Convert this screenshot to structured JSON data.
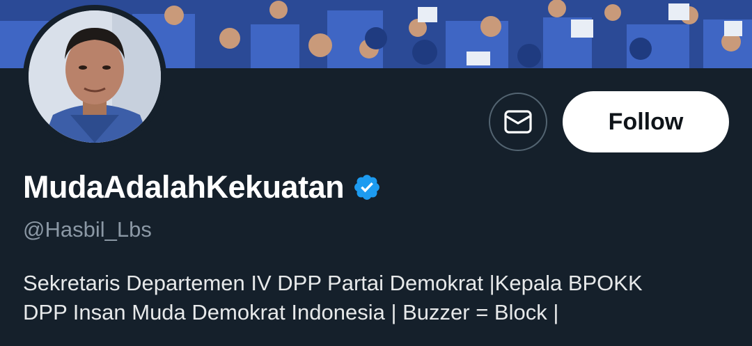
{
  "profile": {
    "display_name": "MudaAdalahKekuatan",
    "handle": "@Hasbil_Lbs",
    "verified": true,
    "bio_lines": [
      "Sekretaris Departemen IV DPP Partai Demokrat |Kepala BPOKK",
      "DPP Insan Muda Demokrat Indonesia | Buzzer = Block |"
    ]
  },
  "actions": {
    "follow_label": "Follow",
    "message_icon": "envelope-icon"
  },
  "colors": {
    "background": "#15202b",
    "verified_badge": "#1d9bf0",
    "handle_text": "#8b98a5",
    "follow_bg": "#ffffff"
  },
  "icons": {
    "verified": "verified-badge-icon",
    "message": "envelope-icon"
  }
}
